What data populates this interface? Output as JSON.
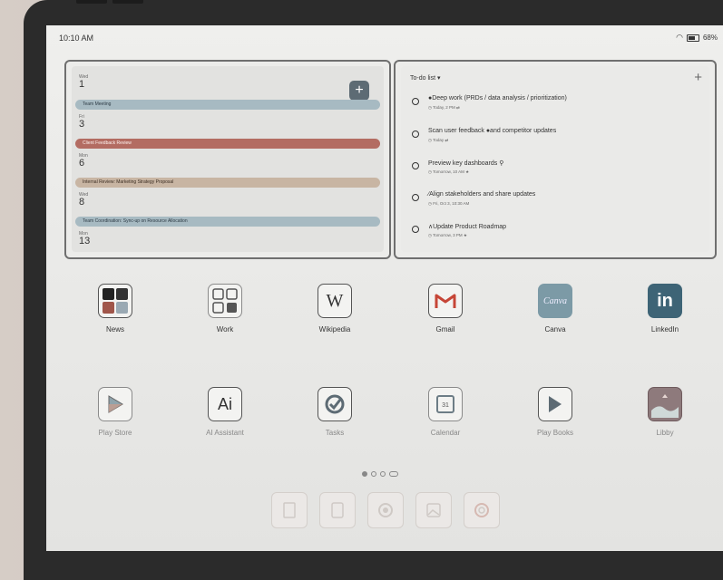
{
  "status": {
    "time": "10:10 AM",
    "battery": "68%"
  },
  "calendar": {
    "days": [
      {
        "dow": "Wed",
        "num": "1"
      },
      {
        "dow": "Fri",
        "num": "3"
      },
      {
        "dow": "Mon",
        "num": "6"
      },
      {
        "dow": "Wed",
        "num": "8"
      },
      {
        "dow": "Mon",
        "num": "13"
      }
    ],
    "events": [
      {
        "label": "Team Meeting",
        "color": "#a7bac2"
      },
      {
        "label": "Client Feedback Review",
        "color": "#b36c62"
      },
      {
        "label": "Internal Review: Marketing Strategy Proposal",
        "color": "#c8b5a3"
      },
      {
        "label": "Team Coordination: Sync-up on Resource Allocation",
        "color": "#a7bac2"
      }
    ]
  },
  "todo": {
    "title": "To-do list",
    "tasks": [
      {
        "title": "●Deep work (PRDs / data analysis / prioritization)",
        "meta": "Today, 2 PM"
      },
      {
        "title": "Scan user feedback ●and competitor updates",
        "meta": "Today"
      },
      {
        "title": "Preview key dashboards",
        "meta": "Tomorrow, 10 AM"
      },
      {
        "title": "∕Align stakeholders and share updates",
        "meta": "Fri, Oct 3, 10:30 AM"
      },
      {
        "title": "∧Update Product Roadmap",
        "meta": "Tomorrow, 3 PM"
      }
    ]
  },
  "apps_row1": [
    {
      "label": "News",
      "icon": "news-folder-icon"
    },
    {
      "label": "Work",
      "icon": "work-folder-icon"
    },
    {
      "label": "Wikipedia",
      "icon": "wikipedia-icon"
    },
    {
      "label": "Gmail",
      "icon": "gmail-icon"
    },
    {
      "label": "Canva",
      "icon": "canva-icon"
    },
    {
      "label": "LinkedIn",
      "icon": "linkedin-icon"
    }
  ],
  "apps_row2": [
    {
      "label": "Play Store",
      "icon": "play-store-icon"
    },
    {
      "label": "AI Assistant",
      "icon": "ai-assistant-icon"
    },
    {
      "label": "Tasks",
      "icon": "tasks-icon"
    },
    {
      "label": "Calendar",
      "icon": "calendar-icon"
    },
    {
      "label": "Play Books",
      "icon": "play-books-icon"
    },
    {
      "label": "Libby",
      "icon": "libby-icon"
    }
  ],
  "icon_text": {
    "wikipedia": "W",
    "ai": "Ai",
    "canva": "Canva",
    "linkedin": "in",
    "calendar_day": "31"
  },
  "colors": {
    "canva": "#7c9aa6",
    "linkedin": "#3e6476",
    "gmail_red": "#c64637"
  }
}
